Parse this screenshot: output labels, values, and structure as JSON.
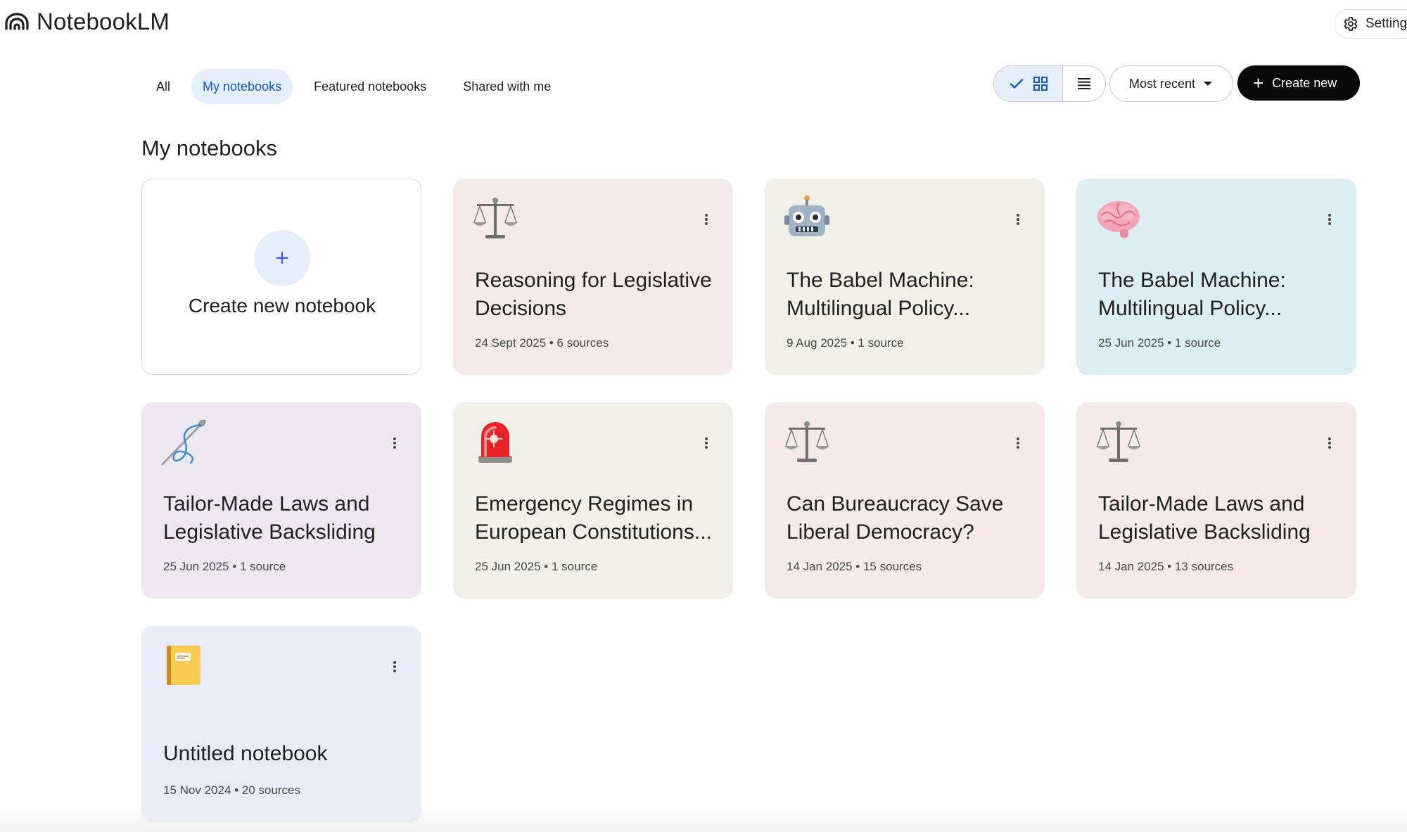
{
  "app": {
    "title": "NotebookLM",
    "logo_icon": "notebooklm-logo-icon"
  },
  "header": {
    "settings_label": "Settings",
    "settings_icon": "gear-icon"
  },
  "tabs": [
    {
      "label": "All",
      "active": false
    },
    {
      "label": "My notebooks",
      "active": true
    },
    {
      "label": "Featured notebooks",
      "active": false
    },
    {
      "label": "Shared with me",
      "active": false
    }
  ],
  "toolbar": {
    "view_mode": "grid",
    "sort_label": "Most recent",
    "create_label": "Create new"
  },
  "section_title": "My notebooks",
  "create_card": {
    "label": "Create new notebook"
  },
  "notebooks": [
    {
      "title": "Reasoning for Legislative Decisions",
      "meta": "24 Sept 2025 • 6 sources",
      "emoji": "balance-scale-icon",
      "bg": "#f5eae8"
    },
    {
      "title": "The Babel Machine: Multilingual Policy...",
      "meta": "9 Aug 2025 • 1 source",
      "emoji": "robot-icon",
      "bg": "#f0f0e8"
    },
    {
      "title": "The Babel Machine: Multilingual Policy...",
      "meta": "25 Jun 2025 • 1 source",
      "emoji": "brain-icon",
      "bg": "#dcedf4"
    },
    {
      "title": "Tailor-Made Laws and Legislative Backsliding",
      "meta": "25 Jun 2025 • 1 source",
      "emoji": "needle-thread-icon",
      "bg": "#ede8ef"
    },
    {
      "title": "Emergency Regimes in European Constitutions...",
      "meta": "25 Jun 2025 • 1 source",
      "emoji": "siren-light-icon",
      "bg": "#f0f0e8"
    },
    {
      "title": "Can Bureaucracy Save Liberal Democracy?",
      "meta": "14 Jan 2025 • 15 sources",
      "emoji": "balance-scale-icon",
      "bg": "#f5eae8"
    },
    {
      "title": "Tailor-Made Laws and Legislative Backsliding",
      "meta": "14 Jan 2025 • 13 sources",
      "emoji": "balance-scale-icon",
      "bg": "#f5eae8"
    },
    {
      "title": "Untitled notebook",
      "meta": "15 Nov 2024 • 20 sources",
      "emoji": "notebook-icon",
      "bg": "#e9ebf7"
    }
  ],
  "colors": {
    "accent": "#0b57d0",
    "active_tab_bg": "#e7eefb",
    "create_button_bg": "#0a0a0a"
  }
}
